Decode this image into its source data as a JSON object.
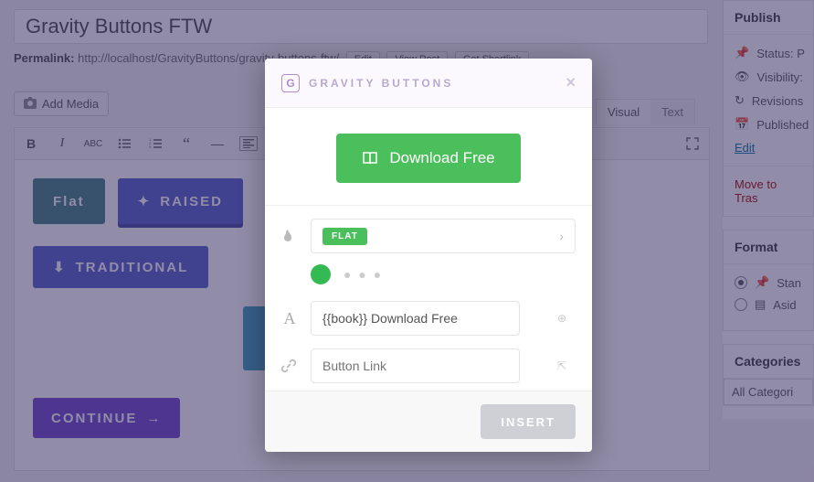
{
  "page": {
    "title": "Gravity Buttons FTW",
    "permalink_label": "Permalink:",
    "permalink_base": "http://localhost/GravityButtons/",
    "permalink_slug": "gravity-buttons-ftw/",
    "perma_buttons": [
      "Edit",
      "View Post",
      "Get Shortlink"
    ],
    "add_media_label": "Add Media",
    "visual_tab": "Visual",
    "text_tab": "Text"
  },
  "demo_buttons": {
    "flat": "Flat",
    "raised": "RAISED",
    "traditional": "TRADITIONAL",
    "continue": "CONTINUE"
  },
  "sidebar": {
    "publish_title": "Publish",
    "status_label": "Status: P",
    "visibility_label": "Visibility:",
    "revisions_label": "Revisions",
    "published_label": "Published",
    "edit_link": "Edit",
    "move_trash": "Move to Tras",
    "format_title": "Format",
    "format_standard": "Stan",
    "format_aside": "Asid",
    "categories_title": "Categories",
    "all_categories": "All Categori"
  },
  "modal": {
    "brand_letter": "G",
    "brand_text": "GRAVITY BUTTONS",
    "preview_label": "Download Free",
    "style_label": "FLAT",
    "text_value": "{{book}} Download Free",
    "link_placeholder": "Button Link",
    "insert_label": "INSERT"
  }
}
